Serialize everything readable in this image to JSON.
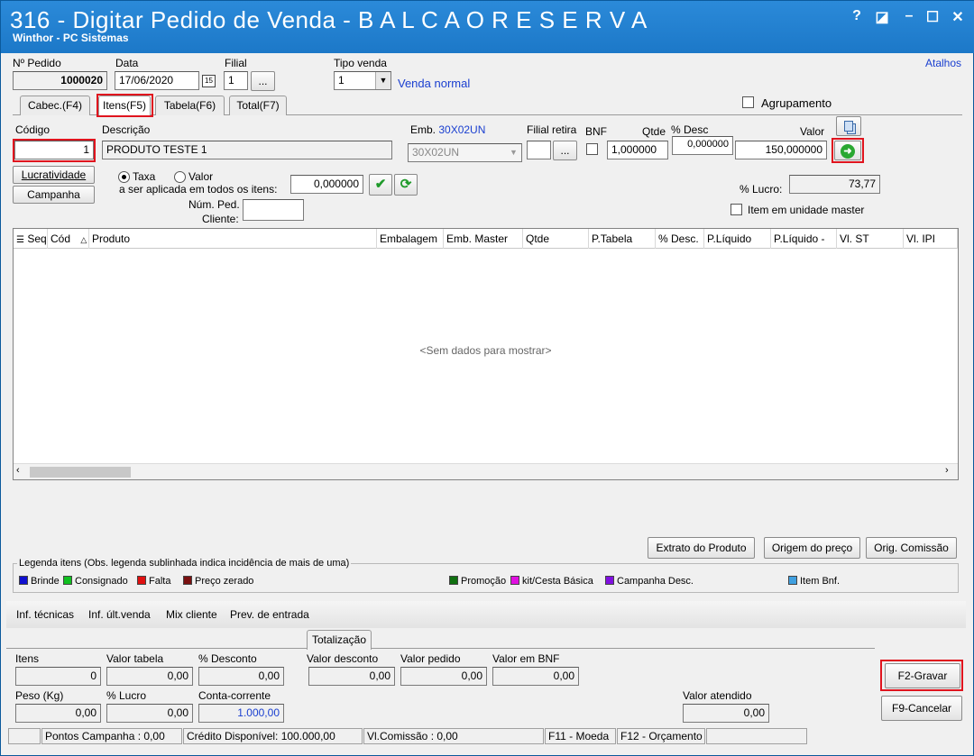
{
  "window": {
    "title": "316 - Digitar Pedido de Venda - B A L C A O  R E S E R V A",
    "subtitle": "Winthor - PC Sistemas",
    "help_glyph": "?",
    "restore_glyph": "◪",
    "minimize_glyph": "–",
    "maximize_glyph": "☐",
    "close_glyph": "✕"
  },
  "header": {
    "pedido_label": "Nº Pedido",
    "pedido_value": "1000020",
    "data_label": "Data",
    "data_value": "17/06/2020",
    "calendar_glyph": "15",
    "filial_label": "Filial",
    "filial_value": "1",
    "filial_btn": "...",
    "tipo_label": "Tipo venda",
    "tipo_value": "1",
    "tipo_desc": "Venda normal",
    "atalhos": "Atalhos"
  },
  "tabs": [
    {
      "label": "Cabec.(F4)"
    },
    {
      "label": "Itens(F5)"
    },
    {
      "label": "Tabela(F6)"
    },
    {
      "label": "Total(F7)"
    }
  ],
  "agrupamento_label": "Agrupamento",
  "item": {
    "codigo_label": "Código",
    "codigo_value": "1",
    "descricao_label": "Descrição",
    "descricao_value": "PRODUTO TESTE 1",
    "emb_label": "Emb.",
    "emb_code": "30X02UN",
    "emb_value": "30X02UN",
    "filial_retira_label": "Filial retira",
    "filial_retira_btn": "...",
    "bnf_label": "BNF",
    "qtde_label": "Qtde",
    "qtde_value": "1,000000",
    "desc_label": "% Desc",
    "desc_value": "0,000000",
    "valor_label": "Valor",
    "valor_value": "150,000000",
    "lucratividade_btn": "Lucratividade",
    "campanha_btn": "Campanha",
    "taxa_label": "Taxa",
    "valor_radio_label": "Valor",
    "aplicada_label": "a ser aplicada em todos os itens:",
    "aplicada_value": "0,000000",
    "num_ped_label1": "Núm. Ped.",
    "num_ped_label2": "Cliente:",
    "lucro_label": "% Lucro:",
    "lucro_value": "73,77",
    "item_master_label": "Item em unidade master"
  },
  "grid": {
    "columns": [
      "Seq",
      "Cód",
      "Produto",
      "Embalagem",
      "Emb. Master",
      "Qtde",
      "P.Tabela",
      "% Desc.",
      "P.Líquido",
      "P.Líquido -",
      "Vl. ST",
      "Vl. IPI"
    ],
    "empty_text": "<Sem dados para mostrar>"
  },
  "actions": {
    "extrato": "Extrato do Produto",
    "origem": "Origem do preço",
    "comissao": "Orig. Comissão"
  },
  "legend": {
    "title": "Legenda itens (Obs. legenda sublinhada indica incidência de mais de uma)",
    "items": [
      {
        "label": "Brinde",
        "color": "#1010d0"
      },
      {
        "label": "Consignado",
        "color": "#10c020"
      },
      {
        "label": "Falta",
        "color": "#e01010"
      },
      {
        "label": "Preço zerado",
        "color": "#7a1010"
      },
      {
        "label": "Promoção",
        "color": "#107010"
      },
      {
        "label": "kit/Cesta Básica",
        "color": "#e010e0"
      },
      {
        "label": "Campanha Desc.",
        "color": "#8010e0"
      },
      {
        "label": "Item Bnf.",
        "color": "#40a0e0"
      }
    ]
  },
  "info_tabs": [
    "Inf. técnicas",
    "Inf. últ.venda",
    "Mix cliente",
    "Prev. de entrada"
  ],
  "totalizacao": {
    "tab": "Totalização",
    "itens_label": "Itens",
    "itens_value": "0",
    "valor_tabela_label": "Valor tabela",
    "valor_tabela_value": "0,00",
    "pct_desconto_label": "% Desconto",
    "pct_desconto_value": "0,00",
    "valor_desconto_label": "Valor desconto",
    "valor_desconto_value": "0,00",
    "valor_pedido_label": "Valor pedido",
    "valor_pedido_value": "0,00",
    "valor_bnf_label": "Valor em BNF",
    "valor_bnf_value": "0,00",
    "peso_label": "Peso (Kg)",
    "peso_value": "0,00",
    "pct_lucro_label": "% Lucro",
    "pct_lucro_value": "0,00",
    "conta_label": "Conta-corrente",
    "conta_value": "1.000,00",
    "valor_atendido_label": "Valor atendido",
    "valor_atendido_value": "0,00",
    "gravar": "F2-Gravar",
    "cancelar": "F9-Cancelar"
  },
  "status": {
    "pontos": "Pontos Campanha : 0,00",
    "credito": "Crédito Disponível: 100.000,00",
    "comissao": "Vl.Comissão : 0,00",
    "f11": "F11 - Moeda",
    "f12": "F12 - Orçamento"
  },
  "colors": {
    "titlebar": "#1c78c8",
    "highlight": "#e0141e",
    "link": "#1a3fd0"
  }
}
